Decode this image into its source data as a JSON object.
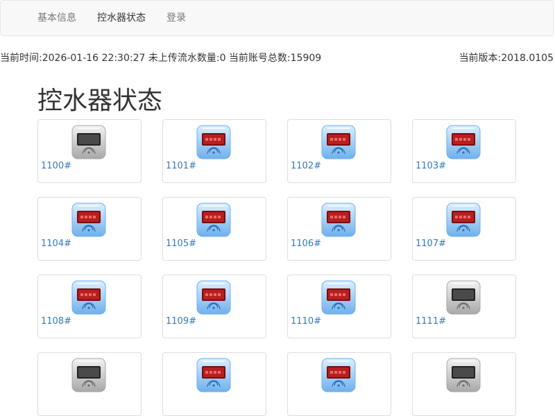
{
  "nav": {
    "items": [
      {
        "label": "基本信息",
        "active": false
      },
      {
        "label": "控水器状态",
        "active": true
      },
      {
        "label": "登录",
        "active": false
      }
    ]
  },
  "status": {
    "text": "当前时间:2026-01-16 22:30:27 未上传流水数量:0 当前账号总数:15909",
    "version": "当前版本:2018.0105"
  },
  "page": {
    "title": "控水器状态"
  },
  "devices": [
    {
      "label": "1100#",
      "state": "offline"
    },
    {
      "label": "1101#",
      "state": "online"
    },
    {
      "label": "1102#",
      "state": "online"
    },
    {
      "label": "1103#",
      "state": "online"
    },
    {
      "label": "1104#",
      "state": "online"
    },
    {
      "label": "1105#",
      "state": "online"
    },
    {
      "label": "1106#",
      "state": "online"
    },
    {
      "label": "1107#",
      "state": "online"
    },
    {
      "label": "1108#",
      "state": "online"
    },
    {
      "label": "1109#",
      "state": "online"
    },
    {
      "label": "1110#",
      "state": "online"
    },
    {
      "label": "1111#",
      "state": "offline"
    },
    {
      "label": "",
      "state": "offline"
    },
    {
      "label": "",
      "state": "online"
    },
    {
      "label": "",
      "state": "online"
    },
    {
      "label": "",
      "state": "offline"
    }
  ]
}
